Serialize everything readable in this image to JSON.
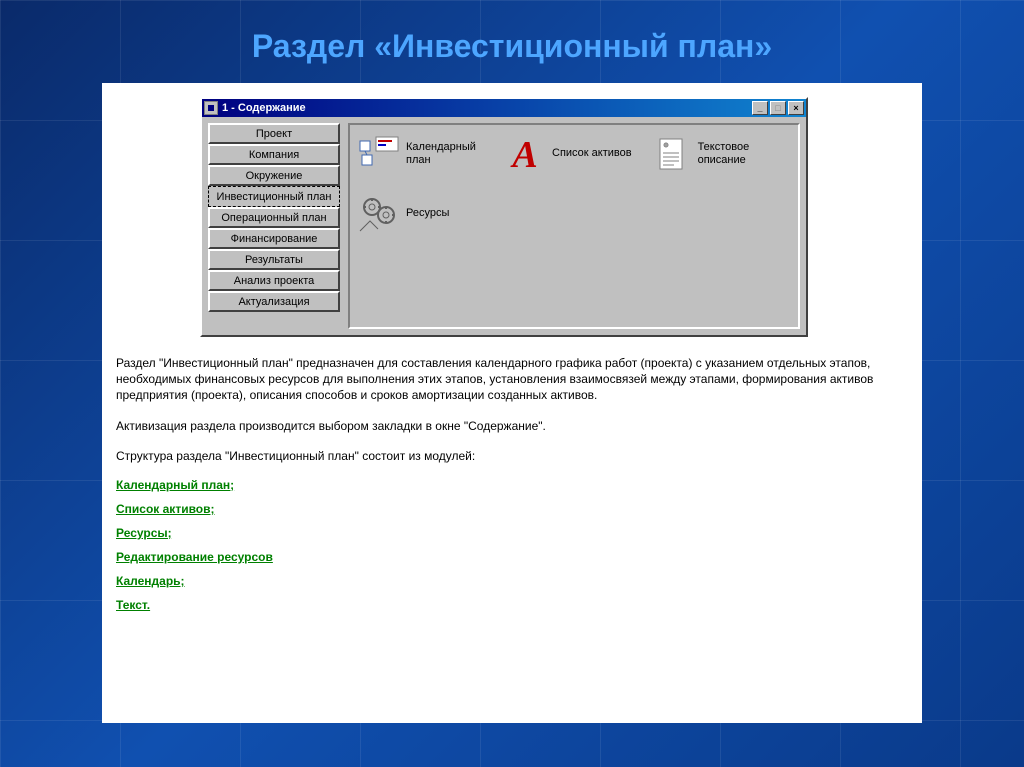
{
  "slide": {
    "title": "Раздел «Инвестиционный план»"
  },
  "window": {
    "title": "1 - Содержание",
    "tabs": [
      {
        "label": "Проект"
      },
      {
        "label": "Компания"
      },
      {
        "label": "Окружение"
      },
      {
        "label": "Инвестиционный план",
        "active": true
      },
      {
        "label": "Операционный план"
      },
      {
        "label": "Финансирование"
      },
      {
        "label": "Результаты"
      },
      {
        "label": "Анализ проекта"
      },
      {
        "label": "Актуализация"
      }
    ],
    "modules": {
      "row1": [
        {
          "icon": "calendar-chart-icon",
          "label": "Календарный план"
        },
        {
          "icon": "letter-a-icon",
          "label": "Список активов"
        },
        {
          "icon": "document-icon",
          "label": "Текстовое описание"
        }
      ],
      "row2": [
        {
          "icon": "gears-icon",
          "label": "Ресурсы"
        }
      ]
    }
  },
  "description": {
    "p1": "Раздел \"Инвестиционный план\" предназначен для составления календарного графика работ (проекта) с указанием отдельных этапов, необходимых финансовых ресурсов для выполнения этих этапов, установления взаимосвязей между этапами, формирования активов предприятия (проекта), описания способов и сроков амортизации созданных активов.",
    "p2": "Активизация раздела производится выбором закладки в окне \"Содержание\".",
    "p3": "Структура раздела \"Инвестиционный план\"  состоит из модулей:"
  },
  "links": [
    "Календарный план;",
    "Список активов;",
    "Ресурсы;",
    "Редактирование ресурсов",
    "Календарь;",
    "Текст."
  ]
}
